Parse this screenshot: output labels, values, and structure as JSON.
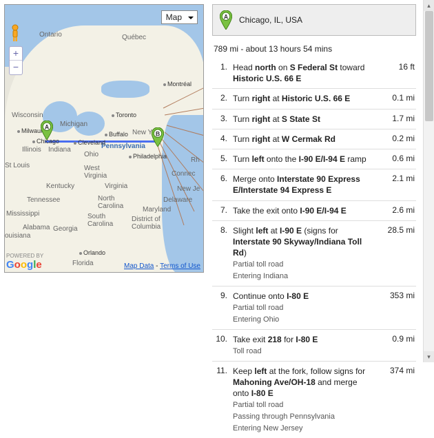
{
  "map": {
    "type_selector": "Map",
    "zoom": {
      "in": "+",
      "out": "−"
    },
    "attribution": {
      "powered_by": "POWERED BY",
      "map_data": "Map Data",
      "terms": "Terms of Use"
    },
    "regions": [
      "Ontario",
      "Québec",
      "Wisconsin",
      "Michigan",
      "Illinois",
      "Indiana",
      "Ohio",
      "Pennsylvania",
      "New York",
      "West Virginia",
      "Kentucky",
      "Virginia",
      "Tennessee",
      "North Carolina",
      "South Carolina",
      "Georgia",
      "Alabama",
      "Mississippi",
      "Florida",
      "Louisiana",
      "Maryland",
      "Delaware",
      "District of Columbia",
      "New Je",
      "Rh",
      "Connec"
    ],
    "cities": [
      "Milwaukee",
      "Chicago",
      "Cleveland",
      "Buffalo",
      "Philadelphia",
      "Orlando",
      "St Louis",
      "Montréal",
      "Toronto"
    ],
    "markers": {
      "a": "A",
      "b": "B"
    }
  },
  "origin_label": "Chicago, IL, USA",
  "summary": "789 mi - about 13 hours 54 mins",
  "steps": [
    {
      "n": "1.",
      "html": "Head <b>north</b> on <b>S Federal St</b> toward <b>Historic U.S. 66 E</b>",
      "dist": "16 ft"
    },
    {
      "n": "2.",
      "html": "Turn <b>right</b> at <b>Historic U.S. 66 E</b>",
      "dist": "0.1 mi"
    },
    {
      "n": "3.",
      "html": "Turn <b>right</b> at <b>S State St</b>",
      "dist": "1.7 mi"
    },
    {
      "n": "4.",
      "html": "Turn <b>right</b> at <b>W Cermak Rd</b>",
      "dist": "0.2 mi"
    },
    {
      "n": "5.",
      "html": "Turn <b>left</b> onto the <b>I-90 E/I-94 E</b> ramp",
      "dist": "0.6 mi"
    },
    {
      "n": "6.",
      "html": "Merge onto <b>Interstate 90 Express E/Interstate 94 Express E</b>",
      "dist": "2.1 mi"
    },
    {
      "n": "7.",
      "html": "Take the exit onto <b>I-90 E/I-94 E</b>",
      "dist": "2.6 mi"
    },
    {
      "n": "8.",
      "html": "Slight <b>left</b> at <b>I-90 E</b> (signs for <b>Interstate 90 Skyway/Indiana Toll Rd</b>)",
      "sub": [
        "Partial toll road",
        "Entering Indiana"
      ],
      "dist": "28.5 mi"
    },
    {
      "n": "9.",
      "html": "Continue onto <b>I-80 E</b>",
      "sub": [
        "Partial toll road",
        "Entering Ohio"
      ],
      "dist": "353 mi"
    },
    {
      "n": "10.",
      "html": "Take exit <b>218</b> for <b>I-80 E</b>",
      "sub": [
        "Toll road"
      ],
      "dist": "0.9 mi"
    },
    {
      "n": "11.",
      "html": "Keep <b>left</b> at the fork, follow signs for <b>Mahoning Ave/OH-18</b> and merge onto <b>I-80 E</b>",
      "sub": [
        "Partial toll road",
        "Passing through Pennsylvania",
        "Entering New Jersey"
      ],
      "dist": "374 mi"
    }
  ]
}
